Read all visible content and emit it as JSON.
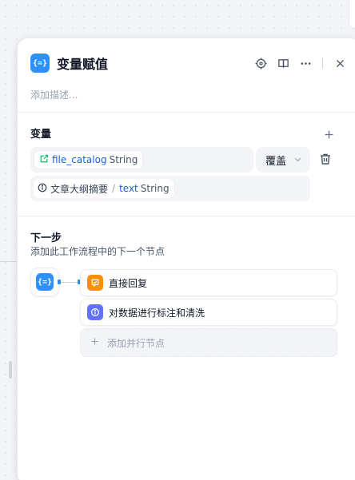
{
  "panel": {
    "title": "变量赋值",
    "description_placeholder": "添加描述...",
    "node_icon_glyph": "{=}",
    "header_icons": [
      "locate-icon",
      "book-icon",
      "more-icon",
      "close-icon"
    ]
  },
  "variables": {
    "section_title": "变量",
    "target": {
      "name": "file_catalog",
      "type": "String"
    },
    "mode": "覆盖",
    "value": {
      "source": "文章大纲摘要",
      "separator": "/",
      "name": "text",
      "type": "String"
    }
  },
  "next_step": {
    "title": "下一步",
    "subtitle": "添加此工作流程中的下一个节点",
    "items": [
      {
        "label": "直接回复",
        "icon": "answer-icon",
        "color": "#f79009"
      },
      {
        "label": "对数据进行标注和清洗",
        "icon": "agent-icon",
        "color": "#6172f3"
      }
    ],
    "add_parallel": "添加并行节点"
  },
  "colors": {
    "accent": "#2e90fa",
    "link": "#155eef"
  }
}
